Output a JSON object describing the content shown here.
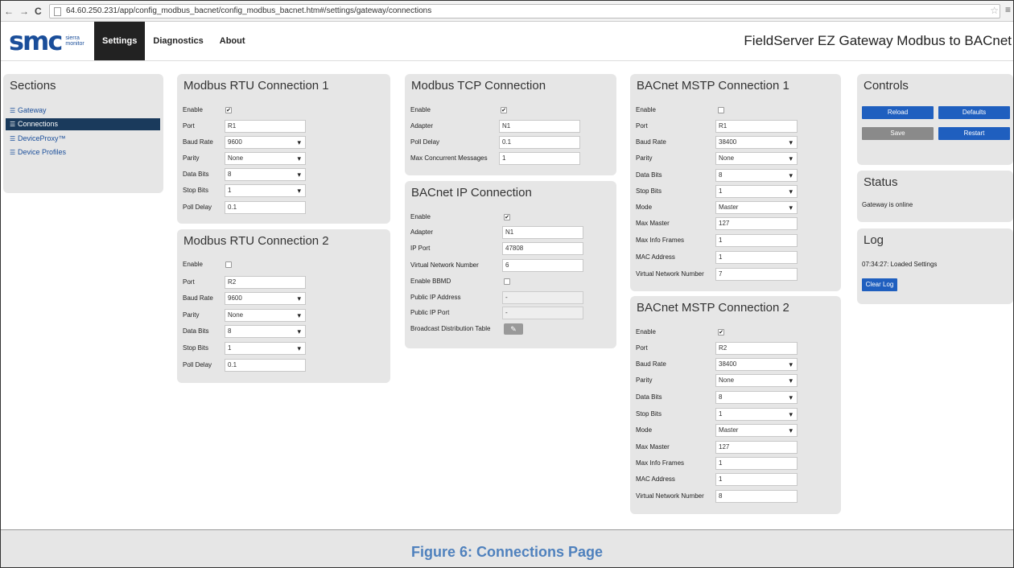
{
  "browser": {
    "url": "64.60.250.231/app/config_modbus_bacnet/config_modbus_bacnet.htm#/settings/gateway/connections"
  },
  "header": {
    "logo_text": "smc",
    "logo_sub_1": "sierra",
    "logo_sub_2": "monitor",
    "tabs": [
      "Settings",
      "Diagnostics",
      "About"
    ],
    "active_tab": "Settings",
    "title": "FieldServer EZ Gateway Modbus to BACnet"
  },
  "sections": {
    "title": "Sections",
    "items": [
      "Gateway",
      "Connections",
      "DeviceProxy™",
      "Device Profiles"
    ],
    "active": "Connections"
  },
  "rtu1": {
    "title": "Modbus RTU Connection 1",
    "enable_label": "Enable",
    "enable": true,
    "port_label": "Port",
    "port": "R1",
    "baud_label": "Baud Rate",
    "baud": "9600",
    "parity_label": "Parity",
    "parity": "None",
    "databits_label": "Data Bits",
    "databits": "8",
    "stopbits_label": "Stop Bits",
    "stopbits": "1",
    "polldelay_label": "Poll Delay",
    "polldelay": "0.1"
  },
  "rtu2": {
    "title": "Modbus RTU Connection 2",
    "enable_label": "Enable",
    "enable": false,
    "port_label": "Port",
    "port": "R2",
    "baud_label": "Baud Rate",
    "baud": "9600",
    "parity_label": "Parity",
    "parity": "None",
    "databits_label": "Data Bits",
    "databits": "8",
    "stopbits_label": "Stop Bits",
    "stopbits": "1",
    "polldelay_label": "Poll Delay",
    "polldelay": "0.1"
  },
  "tcp": {
    "title": "Modbus TCP Connection",
    "enable_label": "Enable",
    "enable": true,
    "adapter_label": "Adapter",
    "adapter": "N1",
    "polldelay_label": "Poll Delay",
    "polldelay": "0.1",
    "maxmsg_label": "Max Concurrent Messages",
    "maxmsg": "1"
  },
  "bip": {
    "title": "BACnet IP Connection",
    "enable_label": "Enable",
    "enable": true,
    "adapter_label": "Adapter",
    "adapter": "N1",
    "ipport_label": "IP Port",
    "ipport": "47808",
    "vnn_label": "Virtual Network Number",
    "vnn": "6",
    "bbmd_label": "Enable BBMD",
    "bbmd": false,
    "pubip_label": "Public IP Address",
    "pubip": "-",
    "pubport_label": "Public IP Port",
    "pubport": "-",
    "bdt_label": "Broadcast Distribution Table"
  },
  "mstp1": {
    "title": "BACnet MSTP Connection 1",
    "enable_label": "Enable",
    "enable": false,
    "port_label": "Port",
    "port": "R1",
    "baud_label": "Baud Rate",
    "baud": "38400",
    "parity_label": "Parity",
    "parity": "None",
    "databits_label": "Data Bits",
    "databits": "8",
    "stopbits_label": "Stop Bits",
    "stopbits": "1",
    "mode_label": "Mode",
    "mode": "Master",
    "maxmaster_label": "Max Master",
    "maxmaster": "127",
    "maxinfo_label": "Max Info Frames",
    "maxinfo": "1",
    "mac_label": "MAC Address",
    "mac": "1",
    "vnn_label": "Virtual Network Number",
    "vnn": "7"
  },
  "mstp2": {
    "title": "BACnet MSTP Connection 2",
    "enable_label": "Enable",
    "enable": true,
    "port_label": "Port",
    "port": "R2",
    "baud_label": "Baud Rate",
    "baud": "38400",
    "parity_label": "Parity",
    "parity": "None",
    "databits_label": "Data Bits",
    "databits": "8",
    "stopbits_label": "Stop Bits",
    "stopbits": "1",
    "mode_label": "Mode",
    "mode": "Master",
    "maxmaster_label": "Max Master",
    "maxmaster": "127",
    "maxinfo_label": "Max Info Frames",
    "maxinfo": "1",
    "mac_label": "MAC Address",
    "mac": "1",
    "vnn_label": "Virtual Network Number",
    "vnn": "8"
  },
  "controls": {
    "title": "Controls",
    "reload": "Reload",
    "defaults": "Defaults",
    "save": "Save",
    "restart": "Restart"
  },
  "status": {
    "title": "Status",
    "text": "Gateway is online"
  },
  "log": {
    "title": "Log",
    "entry": "07:34:27: Loaded Settings",
    "clear": "Clear Log"
  },
  "caption": "Figure 6: Connections Page",
  "colors": {
    "accent": "#1f5fbf",
    "caption": "#4f81bd",
    "panel": "#e6e6e6",
    "active_section": "#1a3a5c"
  }
}
